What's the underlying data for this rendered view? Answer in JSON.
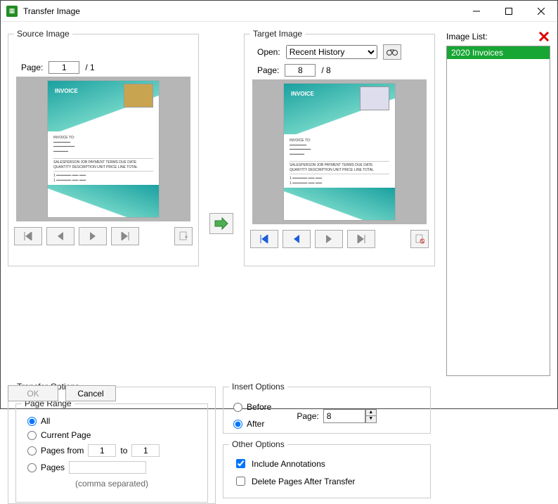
{
  "window": {
    "title": "Transfer Image"
  },
  "source": {
    "legend": "Source Image",
    "page_label": "Page:",
    "page_value": "1",
    "page_of": "/ 1",
    "doc_label": "INVOICE"
  },
  "target": {
    "legend": "Target Image",
    "open_label": "Open:",
    "open_selected": "Recent History",
    "page_label": "Page:",
    "page_value": "8",
    "page_of": "/ 8",
    "doc_label": "INVOICE"
  },
  "image_list": {
    "label": "Image List:",
    "items": [
      "2020 Invoices"
    ]
  },
  "transfer_options": {
    "legend": "Transfer Options",
    "page_range": {
      "legend": "Page Range",
      "all": "All",
      "current": "Current Page",
      "from": "Pages from",
      "from_value": "1",
      "to_label": "to",
      "to_value": "1",
      "pages": "Pages",
      "hint": "(comma separated)"
    }
  },
  "insert_options": {
    "legend": "Insert Options",
    "before": "Before",
    "after": "After",
    "page_label": "Page:",
    "page_value": "8"
  },
  "other_options": {
    "legend": "Other Options",
    "include": "Include Annotations",
    "delete": "Delete Pages After Transfer"
  },
  "buttons": {
    "ok": "OK",
    "cancel": "Cancel"
  }
}
